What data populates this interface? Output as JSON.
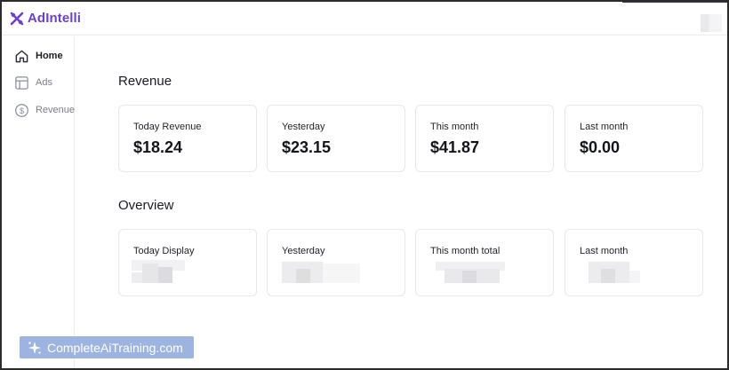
{
  "app": {
    "brand": "AdIntelli",
    "brand_color": "#6a3fd9"
  },
  "sidebar": {
    "items": [
      {
        "label": "Home",
        "icon": "home-icon",
        "active": true
      },
      {
        "label": "Ads",
        "icon": "layout-icon",
        "active": false
      },
      {
        "label": "Revenue",
        "icon": "dollar-circle-icon",
        "active": false
      }
    ]
  },
  "revenue": {
    "title": "Revenue",
    "cards": [
      {
        "label": "Today Revenue",
        "value": "$18.24"
      },
      {
        "label": "Yesterday",
        "value": "$23.15"
      },
      {
        "label": "This month",
        "value": "$41.87"
      },
      {
        "label": "Last month",
        "value": "$0.00"
      }
    ]
  },
  "overview": {
    "title": "Overview",
    "cards": [
      {
        "label": "Today Display"
      },
      {
        "label": "Yesterday"
      },
      {
        "label": "This month total"
      },
      {
        "label": "Last month"
      }
    ]
  },
  "watermark": {
    "text": "CompleteAiTraining.com",
    "icon": "sparkle-icon"
  }
}
